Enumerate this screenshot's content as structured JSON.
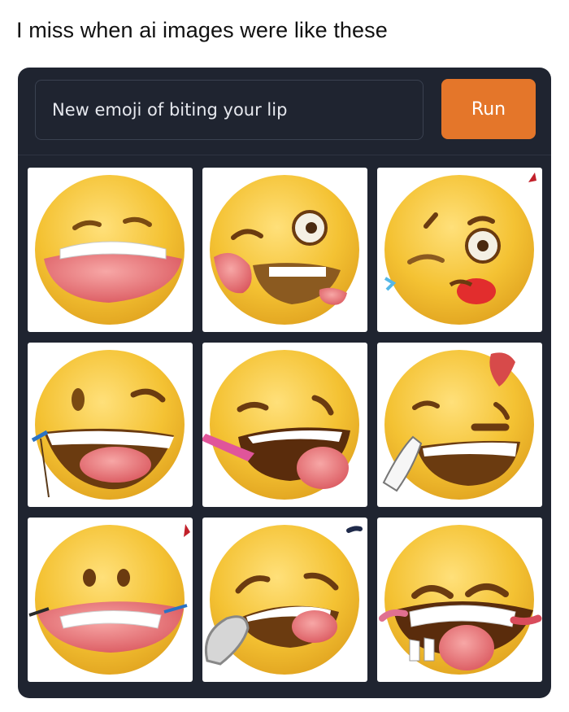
{
  "post": {
    "caption": "I miss when ai images were like these"
  },
  "app": {
    "prompt_value": "New emoji of biting your lip",
    "run_label": "Run"
  },
  "results": {
    "count": 9
  },
  "colors": {
    "panel_bg": "#1f2430",
    "run_button": "#e4762a",
    "emoji_yellow": "#f4c233"
  }
}
